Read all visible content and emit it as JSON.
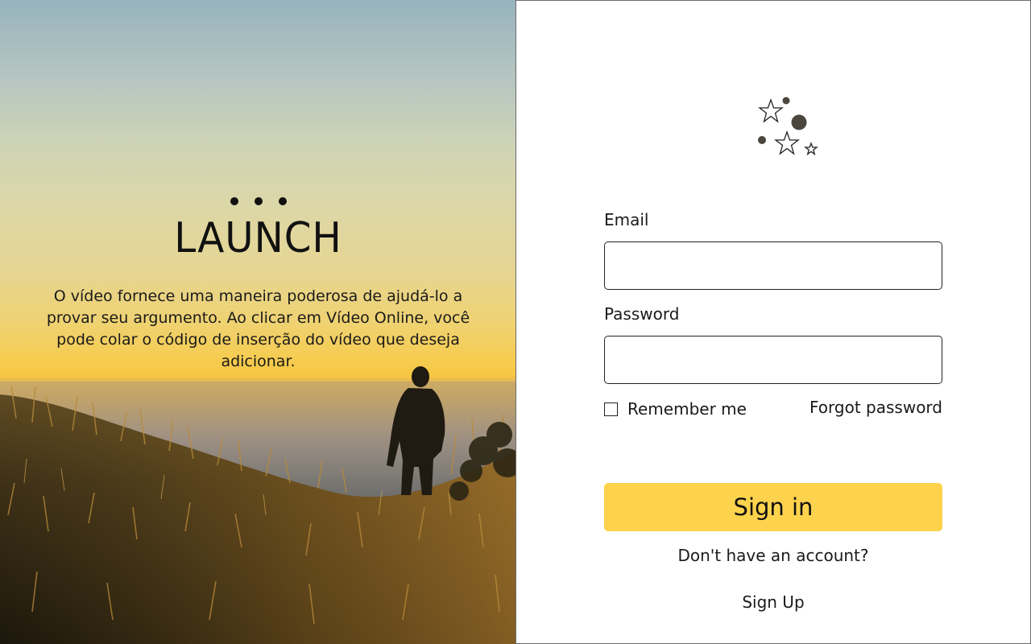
{
  "hero": {
    "title": "LAUNCH",
    "description": "O vídeo fornece uma maneira poderosa de ajudá-lo a provar seu argumento. Ao clicar em Vídeo Online, você pode colar o código de inserção do vídeo que deseja adicionar.",
    "background": "sunset-hillside-photo"
  },
  "brand": {
    "logo_icon": "stars-logo-icon"
  },
  "form": {
    "email_label": "Email",
    "email_value": "",
    "password_label": "Password",
    "password_value": "",
    "remember_label": "Remember me",
    "remember_checked": false,
    "forgot_label": "Forgot password",
    "signin_label": "Sign in",
    "no_account_text": "Don't have an account?",
    "signup_label": "Sign Up"
  },
  "colors": {
    "accent": "#fdd34d",
    "text": "#1a1a1a",
    "border": "#222222"
  }
}
